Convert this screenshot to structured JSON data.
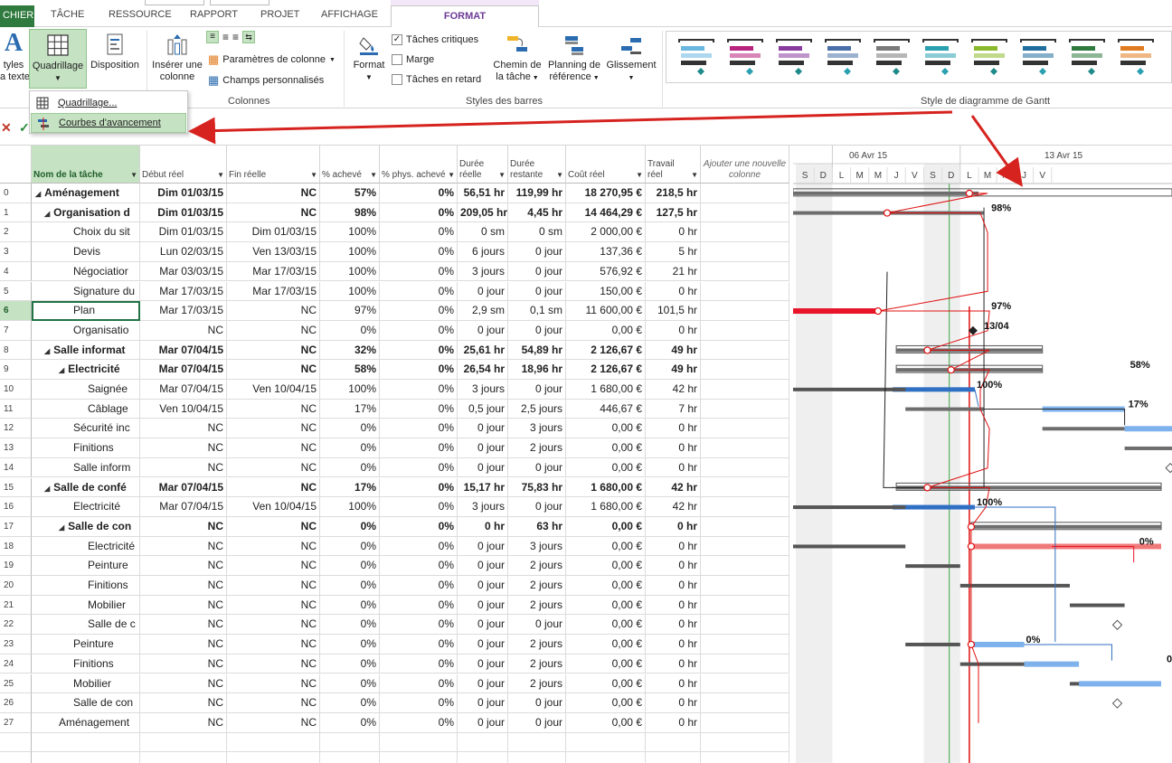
{
  "tabs": [
    {
      "label": "CHIER"
    },
    {
      "label": "TÂCHE"
    },
    {
      "label": "RESSOURCE"
    },
    {
      "label": "RAPPORT"
    },
    {
      "label": "PROJET"
    },
    {
      "label": "AFFICHAGE"
    },
    {
      "label": "FORMAT"
    }
  ],
  "ribbon": {
    "styles_btn": [
      "tyles",
      "a texte"
    ],
    "quadrillage_btn": "Quadrillage",
    "disposition_btn": "Disposition",
    "insert_col_btn": [
      "Insérer une",
      "colonne"
    ],
    "col_settings": "Paramètres de colonne",
    "custom_fields": "Champs personnalisés",
    "group_colonnes": "Colonnes",
    "taches_critiques": "Tâches critiques",
    "marge": "Marge",
    "taches_retard": "Tâches en retard",
    "format_btn": "Format",
    "chemin_btn": [
      "Chemin de",
      "la tâche"
    ],
    "planning_btn": [
      "Planning de",
      "référence"
    ],
    "glissement_btn": "Glissement",
    "group_styles_barres": "Styles des barres",
    "group_gantt_style": "Style de diagramme de Gantt",
    "gallery_colors": [
      "#6ab7e0",
      "#b8237e",
      "#8a3c9e",
      "#4a6fa8",
      "#7a7a7a",
      "#2aa0b0",
      "#8cba2c",
      "#1f6e9e",
      "#2f7a3e",
      "#e07b1f"
    ]
  },
  "dropdown": {
    "items": [
      "Quadrillage...",
      "Courbes d'avancement"
    ]
  },
  "columns": [
    {
      "label": "Nom de la tâche",
      "arrow": "▼"
    },
    {
      "label": "Début réel",
      "arrow": "▼"
    },
    {
      "label": "Fin réelle",
      "arrow": "▼"
    },
    {
      "label": "% achevé",
      "arrow": "▼"
    },
    {
      "label": "% phys. achevé",
      "arrow": "▼"
    },
    {
      "label": "Durée réelle",
      "arrow": "▼"
    },
    {
      "label": "Durée restante",
      "arrow": "▼"
    },
    {
      "label": "Coût réel",
      "arrow": "▼"
    },
    {
      "label": "Travail réel",
      "arrow": "▼"
    },
    {
      "label": "Ajouter une nouvelle colonne",
      "arrow": "▼"
    }
  ],
  "rows": [
    {
      "id": "0",
      "level": 0,
      "summary": true,
      "name": "Aménagement",
      "start": "Dim 01/03/15",
      "end": "NC",
      "pct": "57%",
      "phys": "0%",
      "dur": "56,51 hr",
      "rem": "119,99 hr",
      "cost": "18 270,95 €",
      "work": "218,5 hr"
    },
    {
      "id": "1",
      "level": 1,
      "summary": true,
      "name": "Organisation d",
      "start": "Dim 01/03/15",
      "end": "NC",
      "pct": "98%",
      "phys": "0%",
      "dur": "209,05 hr",
      "rem": "4,45 hr",
      "cost": "14 464,29 €",
      "work": "127,5 hr"
    },
    {
      "id": "2",
      "level": 2,
      "summary": false,
      "name": "Choix du sit",
      "start": "Dim 01/03/15",
      "end": "Dim 01/03/15",
      "pct": "100%",
      "phys": "0%",
      "dur": "0 sm",
      "rem": "0 sm",
      "cost": "2 000,00 €",
      "work": "0 hr"
    },
    {
      "id": "3",
      "level": 2,
      "summary": false,
      "name": "Devis",
      "start": "Lun 02/03/15",
      "end": "Ven 13/03/15",
      "pct": "100%",
      "phys": "0%",
      "dur": "6 jours",
      "rem": "0 jour",
      "cost": "137,36 €",
      "work": "5 hr"
    },
    {
      "id": "4",
      "level": 2,
      "summary": false,
      "name": "Négociatior",
      "start": "Mar 03/03/15",
      "end": "Mar 17/03/15",
      "pct": "100%",
      "phys": "0%",
      "dur": "3 jours",
      "rem": "0 jour",
      "cost": "576,92 €",
      "work": "21 hr"
    },
    {
      "id": "5",
      "level": 2,
      "summary": false,
      "name": "Signature du",
      "start": "Mar 17/03/15",
      "end": "Mar 17/03/15",
      "pct": "100%",
      "phys": "0%",
      "dur": "0 jour",
      "rem": "0 jour",
      "cost": "150,00 €",
      "work": "0 hr"
    },
    {
      "id": "6",
      "level": 2,
      "summary": false,
      "name": "Plan",
      "start": "Mar 17/03/15",
      "end": "NC",
      "pct": "97%",
      "phys": "0%",
      "dur": "2,9 sm",
      "rem": "0,1 sm",
      "cost": "11 600,00 €",
      "work": "101,5 hr",
      "selected": true
    },
    {
      "id": "7",
      "level": 2,
      "summary": false,
      "name": "Organisatio",
      "start": "NC",
      "end": "NC",
      "pct": "0%",
      "phys": "0%",
      "dur": "0 jour",
      "rem": "0 jour",
      "cost": "0,00 €",
      "work": "0 hr"
    },
    {
      "id": "8",
      "level": 1,
      "summary": true,
      "name": "Salle informat",
      "start": "Mar 07/04/15",
      "end": "NC",
      "pct": "32%",
      "phys": "0%",
      "dur": "25,61 hr",
      "rem": "54,89 hr",
      "cost": "2 126,67 €",
      "work": "49 hr"
    },
    {
      "id": "9",
      "level": 2,
      "summary": true,
      "name": "Electricité",
      "start": "Mar 07/04/15",
      "end": "NC",
      "pct": "58%",
      "phys": "0%",
      "dur": "26,54 hr",
      "rem": "18,96 hr",
      "cost": "2 126,67 €",
      "work": "49 hr"
    },
    {
      "id": "10",
      "level": 3,
      "summary": false,
      "name": "Saignée",
      "start": "Mar 07/04/15",
      "end": "Ven 10/04/15",
      "pct": "100%",
      "phys": "0%",
      "dur": "3 jours",
      "rem": "0 jour",
      "cost": "1 680,00 €",
      "work": "42 hr"
    },
    {
      "id": "11",
      "level": 3,
      "summary": false,
      "name": "Câblage",
      "start": "Ven 10/04/15",
      "end": "NC",
      "pct": "17%",
      "phys": "0%",
      "dur": "0,5 jour",
      "rem": "2,5 jours",
      "cost": "446,67 €",
      "work": "7 hr"
    },
    {
      "id": "12",
      "level": 2,
      "summary": false,
      "name": "Sécurité inc",
      "start": "NC",
      "end": "NC",
      "pct": "0%",
      "phys": "0%",
      "dur": "0 jour",
      "rem": "3 jours",
      "cost": "0,00 €",
      "work": "0 hr"
    },
    {
      "id": "13",
      "level": 2,
      "summary": false,
      "name": "Finitions",
      "start": "NC",
      "end": "NC",
      "pct": "0%",
      "phys": "0%",
      "dur": "0 jour",
      "rem": "2 jours",
      "cost": "0,00 €",
      "work": "0 hr"
    },
    {
      "id": "14",
      "level": 2,
      "summary": false,
      "name": "Salle inform",
      "start": "NC",
      "end": "NC",
      "pct": "0%",
      "phys": "0%",
      "dur": "0 jour",
      "rem": "0 jour",
      "cost": "0,00 €",
      "work": "0 hr"
    },
    {
      "id": "15",
      "level": 1,
      "summary": true,
      "name": "Salle de confé",
      "start": "Mar 07/04/15",
      "end": "NC",
      "pct": "17%",
      "phys": "0%",
      "dur": "15,17 hr",
      "rem": "75,83 hr",
      "cost": "1 680,00 €",
      "work": "42 hr"
    },
    {
      "id": "16",
      "level": 2,
      "summary": false,
      "name": "Electricité",
      "start": "Mar 07/04/15",
      "end": "Ven 10/04/15",
      "pct": "100%",
      "phys": "0%",
      "dur": "3 jours",
      "rem": "0 jour",
      "cost": "1 680,00 €",
      "work": "42 hr"
    },
    {
      "id": "17",
      "level": 2,
      "summary": true,
      "name": "Salle de con",
      "start": "NC",
      "end": "NC",
      "pct": "0%",
      "phys": "0%",
      "dur": "0 hr",
      "rem": "63 hr",
      "cost": "0,00 €",
      "work": "0 hr"
    },
    {
      "id": "18",
      "level": 3,
      "summary": false,
      "name": "Electricité",
      "start": "NC",
      "end": "NC",
      "pct": "0%",
      "phys": "0%",
      "dur": "0 jour",
      "rem": "3 jours",
      "cost": "0,00 €",
      "work": "0 hr"
    },
    {
      "id": "19",
      "level": 3,
      "summary": false,
      "name": "Peinture",
      "start": "NC",
      "end": "NC",
      "pct": "0%",
      "phys": "0%",
      "dur": "0 jour",
      "rem": "2 jours",
      "cost": "0,00 €",
      "work": "0 hr"
    },
    {
      "id": "20",
      "level": 3,
      "summary": false,
      "name": "Finitions",
      "start": "NC",
      "end": "NC",
      "pct": "0%",
      "phys": "0%",
      "dur": "0 jour",
      "rem": "2 jours",
      "cost": "0,00 €",
      "work": "0 hr"
    },
    {
      "id": "21",
      "level": 3,
      "summary": false,
      "name": "Mobilier",
      "start": "NC",
      "end": "NC",
      "pct": "0%",
      "phys": "0%",
      "dur": "0 jour",
      "rem": "2 jours",
      "cost": "0,00 €",
      "work": "0 hr"
    },
    {
      "id": "22",
      "level": 3,
      "summary": false,
      "name": "Salle de c",
      "start": "NC",
      "end": "NC",
      "pct": "0%",
      "phys": "0%",
      "dur": "0 jour",
      "rem": "0 jour",
      "cost": "0,00 €",
      "work": "0 hr"
    },
    {
      "id": "23",
      "level": 2,
      "summary": false,
      "name": "Peinture",
      "start": "NC",
      "end": "NC",
      "pct": "0%",
      "phys": "0%",
      "dur": "0 jour",
      "rem": "2 jours",
      "cost": "0,00 €",
      "work": "0 hr"
    },
    {
      "id": "24",
      "level": 2,
      "summary": false,
      "name": "Finitions",
      "start": "NC",
      "end": "NC",
      "pct": "0%",
      "phys": "0%",
      "dur": "0 jour",
      "rem": "2 jours",
      "cost": "0,00 €",
      "work": "0 hr"
    },
    {
      "id": "25",
      "level": 2,
      "summary": false,
      "name": "Mobilier",
      "start": "NC",
      "end": "NC",
      "pct": "0%",
      "phys": "0%",
      "dur": "0 jour",
      "rem": "2 jours",
      "cost": "0,00 €",
      "work": "0 hr"
    },
    {
      "id": "26",
      "level": 2,
      "summary": false,
      "name": "Salle de con",
      "start": "NC",
      "end": "NC",
      "pct": "0%",
      "phys": "0%",
      "dur": "0 jour",
      "rem": "0 jour",
      "cost": "0,00 €",
      "work": "0 hr"
    },
    {
      "id": "27",
      "level": 1,
      "summary": false,
      "name": "Aménagement",
      "start": "NC",
      "end": "NC",
      "pct": "0%",
      "phys": "0%",
      "dur": "0 jour",
      "rem": "0 jour",
      "cost": "0,00 €",
      "work": "0 hr"
    }
  ],
  "gantt": {
    "weeks": [
      "06 Avr 15",
      "13 Avr 15"
    ],
    "days": [
      "S",
      "D",
      "L",
      "M",
      "M",
      "J",
      "V",
      "S",
      "D",
      "L",
      "M",
      "M",
      "J",
      "V"
    ],
    "bar_labels": [
      {
        "row": 1,
        "text": "98%"
      },
      {
        "row": 6,
        "text": "97%"
      },
      {
        "row": 7,
        "text": "13/04"
      },
      {
        "row": 9,
        "text": "58%"
      },
      {
        "row": 10,
        "text": "100%"
      },
      {
        "row": 11,
        "text": "17%"
      },
      {
        "row": 16,
        "text": "100%"
      },
      {
        "row": 18,
        "text": "0%"
      },
      {
        "row": 23,
        "text": "0%"
      },
      {
        "row": 24,
        "text": "0"
      }
    ],
    "colors": {
      "summary": "#6d6d6d",
      "critical": "#e8142a",
      "done": "#2f6fc4",
      "todo": "#7eb2ec",
      "critical_todo": "#f07a7a",
      "progress_line": "#e01010",
      "status_date": "#3aa641",
      "baseline": "#555555"
    }
  }
}
